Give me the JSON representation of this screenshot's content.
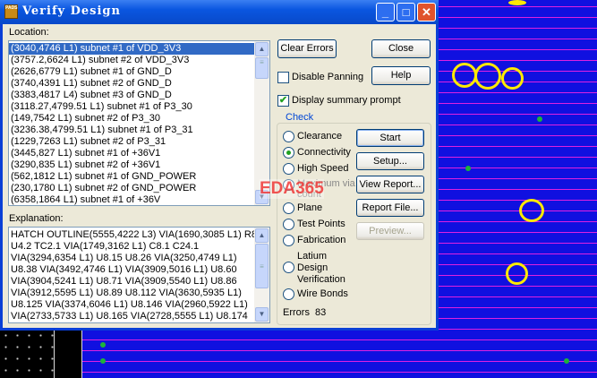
{
  "window": {
    "title": "Verify Design",
    "app_icon_text": "PADS",
    "controls": [
      "minimize",
      "maximize",
      "close"
    ]
  },
  "location": {
    "label": "Location:",
    "items": [
      "(3040,4746 L1) subnet #1 of VDD_3V3",
      "(3757.2,6624 L1) subnet #2 of VDD_3V3",
      "(2626,6779 L1) subnet #1 of GND_D",
      "(3740,4391 L1) subnet #2 of GND_D",
      "(3383,4817 L4) subnet #3 of GND_D",
      "(3118.27,4799.51 L1) subnet #1 of P3_30",
      "(149,7542 L1) subnet #2 of P3_30",
      "(3236.38,4799.51 L1) subnet #1 of P3_31",
      "(1229,7263 L1) subnet #2 of P3_31",
      "(3445,827 L1) subnet #1 of +36V1",
      "(3290,835 L1) subnet #2 of +36V1",
      "(562,1812 L1) subnet #1 of GND_POWER",
      "(230,1780 L1) subnet #2 of GND_POWER",
      "(6358,1864 L1) subnet #1 of +36V"
    ],
    "selected_index": 0
  },
  "explanation": {
    "label": "Explanation:",
    "lines": [
      "HATCH OUTLINE(5555,4222 L3) VIA(1690,3085 L1) R8.",
      "U4.2 TC2.1 VIA(1749,3162 L1) C8.1 C24.1",
      "VIA(3294,6354 L1) U8.15 U8.26 VIA(3250,4749 L1)",
      "U8.38 VIA(3492,4746 L1) VIA(3909,5016 L1) U8.60",
      "VIA(3904,5241 L1) U8.71 VIA(3909,5540 L1) U8.86",
      "VIA(3912,5595 L1) U8.89 U8.112 VIA(3630,5935 L1)",
      "U8.125 VIA(3374,6046 L1) U8.146 VIA(2960,5922 L1)",
      "VIA(2733,5733 L1) U8.165 VIA(2728,5555 L1) U8.174"
    ]
  },
  "buttons": {
    "clear_errors": "Clear Errors",
    "close": "Close",
    "help": "Help",
    "start": "Start",
    "setup": "Setup...",
    "view_report": "View Report...",
    "report_file": "Report File...",
    "preview": "Preview..."
  },
  "options": {
    "disable_panning": {
      "label": "Disable Panning",
      "checked": false
    },
    "display_summary": {
      "label": "Display summary prompt",
      "checked": true
    }
  },
  "check": {
    "title": "Check",
    "options": [
      "Clearance",
      "Connectivity",
      "High Speed",
      "Maximum via count",
      "Plane",
      "Test Points",
      "Fabrication",
      "Latium Design Verification",
      "Wire Bonds"
    ],
    "selected": "Connectivity"
  },
  "errors": {
    "label": "Errors",
    "value": "83"
  },
  "watermark": "EDA365"
}
